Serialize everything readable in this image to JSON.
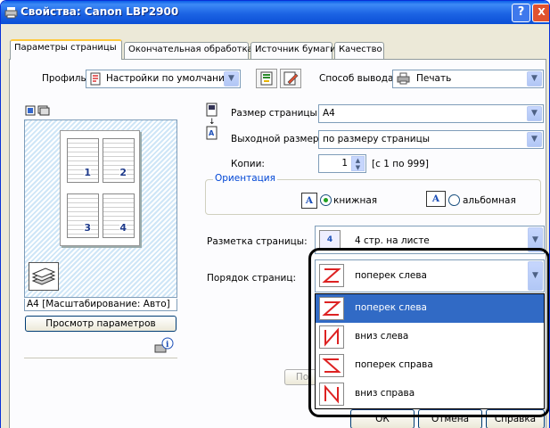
{
  "window": {
    "title": "Свойства: Canon LBP2900",
    "help_label": "?",
    "close_label": "X"
  },
  "tabs": [
    {
      "label": "Параметры страницы"
    },
    {
      "label": "Окончательная обработка"
    },
    {
      "label": "Источник бумаги"
    },
    {
      "label": "Качество"
    }
  ],
  "profile": {
    "label": "Профиль:",
    "value": "Настройки по умолчанию"
  },
  "output_method": {
    "label": "Способ вывода:",
    "value": "Печать"
  },
  "page_size": {
    "label": "Размер страницы:",
    "value": "A4"
  },
  "output_size": {
    "label": "Выходной размер:",
    "value": "по размеру страницы"
  },
  "copies": {
    "label": "Копии:",
    "value": "1",
    "range": "[с 1 по 999]"
  },
  "orientation": {
    "label": "Ориентация",
    "portrait": "книжная",
    "landscape": "альбомная",
    "selected": "книжная"
  },
  "layout": {
    "label": "Разметка страницы:",
    "value": "4 стр. на листе"
  },
  "page_order": {
    "label": "Порядок страниц:",
    "value": "поперек слева",
    "options": [
      "поперек слева",
      "вниз слева",
      "поперек справа",
      "вниз справа"
    ],
    "selected_index": 0
  },
  "preview": {
    "caption": "A4 [Масштабирование: Авто]",
    "pages": [
      "1",
      "2",
      "3",
      "4"
    ],
    "view_settings_button": "Просмотр параметров"
  },
  "partial_button": "По",
  "bottom_buttons": [
    "ОК",
    "Отмена",
    "Справка"
  ],
  "colors": {
    "titlebar": "#0a5ee8",
    "selection": "#316ac5",
    "accent_tab": "#ffc83c"
  }
}
